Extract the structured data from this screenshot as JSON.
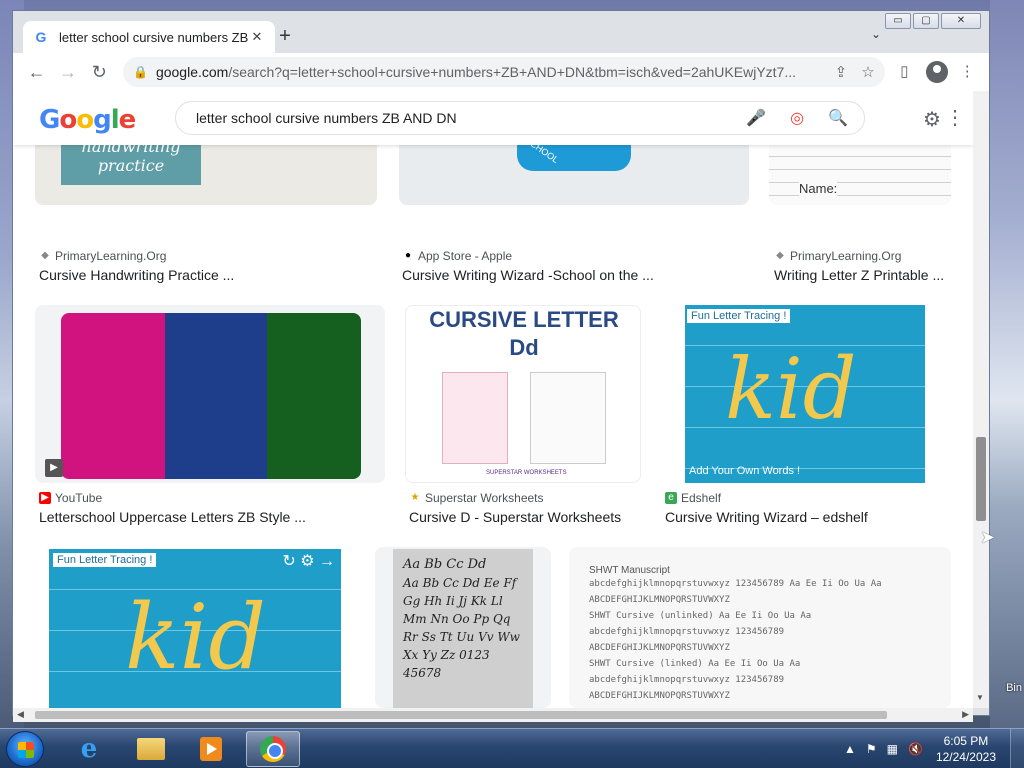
{
  "window": {
    "minimize": "▭",
    "maximize": "▢",
    "close": "✕"
  },
  "tab": {
    "favicon": "G",
    "title": "letter school cursive numbers ZB",
    "close": "✕",
    "new_tab": "+",
    "menu": "⌄"
  },
  "toolbar": {
    "back": "←",
    "forward": "→",
    "reload": "↻",
    "lock": "🔒",
    "url_host": "google.com",
    "url_path": "/search?q=letter+school+cursive+numbers+ZB+AND+DN&tbm=isch&ved=2ahUKEwjYzt7...",
    "share": "⇪",
    "bookmark": "☆",
    "side_panel": "▯",
    "menu": "⋮"
  },
  "google": {
    "logo": [
      "G",
      "o",
      "o",
      "g",
      "l",
      "e"
    ],
    "query": "letter school cursive numbers ZB AND DN",
    "mic": "🎤",
    "lens": "◎",
    "search": "🔍",
    "settings": "⚙",
    "apps": "⋮⋮⋮"
  },
  "results": [
    {
      "source": "PrimaryLearning.Org",
      "title": "Cursive Handwriting Practice ...",
      "source_icon": "◆",
      "thumb_text": "handwriting practice",
      "icon_color": "#888888"
    },
    {
      "source": "App Store - Apple",
      "title": "Cursive Writing Wizard -School on the ...",
      "source_icon": "●",
      "thumb_text": "SCHOOL",
      "icon_color": "#000000"
    },
    {
      "source": "PrimaryLearning.Org",
      "title": "Writing Letter Z Printable ...",
      "source_icon": "◆",
      "thumb_text": "Name:",
      "icon_color": "#888888"
    },
    {
      "source": "YouTube",
      "title": "Letterschool Uppercase Letters ZB Style ...",
      "source_icon": "▶",
      "thumb_text": "",
      "icon_color": "#ff0000"
    },
    {
      "source": "Superstar Worksheets",
      "title": "Cursive D - Superstar Worksheets",
      "source_icon": "★",
      "thumb_text": "CURSIVE LETTER Dd",
      "icon_color": "#e0a400"
    },
    {
      "source": "Edshelf",
      "title": "Cursive Writing Wizard – edshelf",
      "source_icon": "e",
      "thumb_text": "Fun Letter Tracing !",
      "icon_color": "#3aa757"
    },
    {
      "source": "",
      "title": "",
      "source_icon": "",
      "thumb_text": "Fun Letter Tracing !",
      "icon_color": ""
    },
    {
      "source": "",
      "title": "",
      "source_icon": "",
      "thumb_text": "Aa Bb Cc Dd",
      "icon_color": ""
    },
    {
      "source": "",
      "title": "",
      "source_icon": "",
      "thumb_text": "SHWT Manuscript",
      "icon_color": ""
    }
  ],
  "thumb_extras": {
    "kid_word": "kid",
    "add_words": "Add Your Own Words !",
    "cursive_letters": "Aa Bb Cc Dd Ee Ff Gg Hh Ii Jj Kk Ll Mm Nn Oo Pp Qq Rr Ss Tt Uu Vv Ww Xx Yy Zz 0123 45678",
    "manu_lines": [
      "abcdefghijklmnopqrstuvwxyz 123456789 Aa Ee Ii Oo Ua Aa",
      "ABCDEFGHIJKLMNOPQRSTUVWXYZ",
      "SHWT Cursive (unlinked) Aa Ee Ii Oo Ua Aa",
      "abcdefghijklmnopqrstuvwxyz 123456789",
      "ABCDEFGHIJKLMNOPQRSTUVWXYZ",
      "SHWT Cursive (linked) Aa Ee Ii Oo Ua Aa",
      "abcdefghijklmnopqrstuvwxyz 123456789",
      "ABCDEFGHIJKLMNOPQRSTUVWXYZ"
    ],
    "superstar_tag": "SUPERSTAR WORKSHEETS"
  },
  "desktop": {
    "recycle_label": "Bin"
  },
  "taskbar": {
    "time": "6:05 PM",
    "date": "12/24/2023",
    "tray_up": "▲",
    "tray_flag": "⚑",
    "tray_net": "▦",
    "tray_vol": "🔇"
  }
}
